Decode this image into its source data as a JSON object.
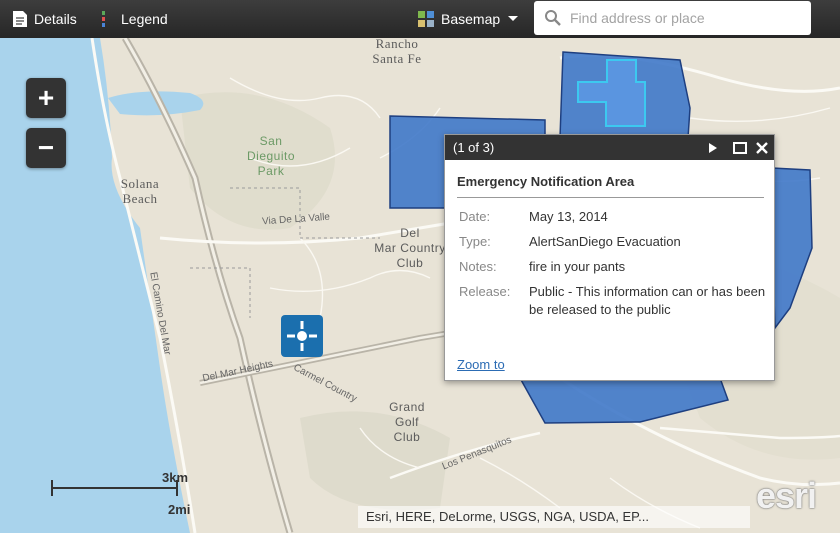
{
  "toolbar": {
    "details_label": "Details",
    "legend_label": "Legend",
    "basemap_label": "Basemap",
    "search_placeholder": "Find address or place"
  },
  "map": {
    "places": {
      "rancho_santa_fe": "Rancho\nSanta Fe",
      "solana_beach": "Solana\nBeach",
      "san_dieguito_park": "San\nDieguito\nPark",
      "del_mar_country_club": "Del\nMar Country\nClub",
      "grand_golf_club": "Grand\nGolf\nClub"
    },
    "roads": {
      "del_mar_heights": "Del Mar Heights",
      "carmel_country": "Carmel Country",
      "del_dios": "El Camino Del Mar",
      "los_penasquitos": "Los Penasquitos",
      "via_de_la_valle": "Via De La Valle"
    },
    "zoom_in_label": "+",
    "zoom_out_label": "−",
    "scale": {
      "km": "3km",
      "mi": "2mi"
    },
    "attribution": "Esri, HERE, DeLorme, USGS, NGA, USDA, EP...",
    "logo": "esri",
    "colors": {
      "polygon_fill": "#3f78c9",
      "polygon_stroke": "#1e3f80",
      "highlight": "#3cc9f0",
      "water": "#a9d3ec"
    }
  },
  "popup": {
    "pager": "(1 of 3)",
    "title": "Emergency Notification Area",
    "fields": [
      {
        "key": "Date:",
        "value": "May 13, 2014"
      },
      {
        "key": "Type:",
        "value": "AlertSanDiego Evacuation"
      },
      {
        "key": "Notes:",
        "value": "fire in your pants"
      },
      {
        "key": "Release:",
        "value": "Public - This information can or has been be released to the public"
      }
    ],
    "zoom_to": "Zoom to"
  }
}
